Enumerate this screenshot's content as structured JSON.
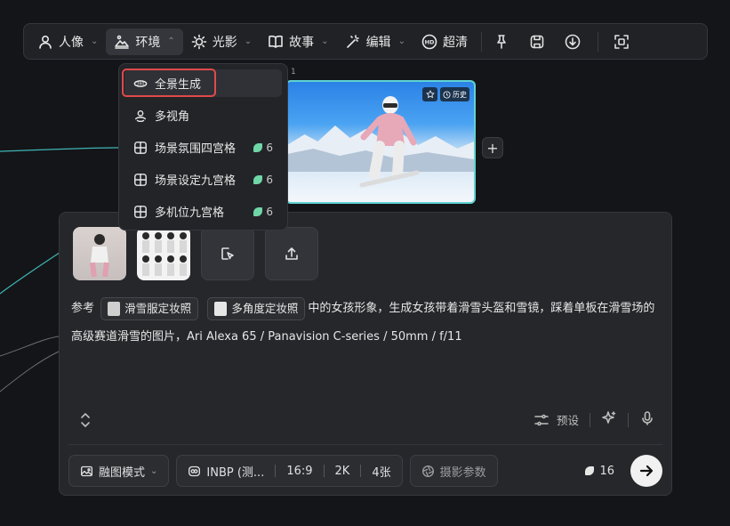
{
  "toolbar": {
    "items": [
      {
        "label": "人像",
        "icon": "person-icon"
      },
      {
        "label": "环境",
        "icon": "landscape-icon"
      },
      {
        "label": "光影",
        "icon": "sun-icon"
      },
      {
        "label": "故事",
        "icon": "book-icon"
      },
      {
        "label": "编辑",
        "icon": "magic-wand-icon"
      },
      {
        "label": "超清",
        "icon": "hd-icon"
      }
    ],
    "right_icons": [
      "pin-icon",
      "save-icon",
      "download-icon",
      "fullscreen-icon"
    ]
  },
  "dropdown": {
    "items": [
      {
        "label": "全景生成",
        "icon": "360-icon"
      },
      {
        "label": "多视角",
        "icon": "multi-view-icon"
      },
      {
        "label": "场景氛围四宫格",
        "icon": "grid-icon",
        "count": "6"
      },
      {
        "label": "场景设定九宫格",
        "icon": "grid-icon",
        "count": "6"
      },
      {
        "label": "多机位九宫格",
        "icon": "grid-icon",
        "count": "6"
      }
    ]
  },
  "image_card": {
    "node_label": "1",
    "history_label": "历史"
  },
  "prompt": {
    "prefix": "参考",
    "ref1": "滑雪服定妆照",
    "ref2": "多角度定妆照",
    "text": "中的女孩形象，生成女孩带着滑雪头盔和雪镜，踩着单板在滑雪场的高级赛道滑雪的图片，Ari Alexa 65 / Panavision C-series / 50mm / f/11"
  },
  "panel_tools": {
    "preset_label": "预设"
  },
  "bottom_bar": {
    "mode_label": "融图模式",
    "model_label": "INBP (测...",
    "ratio": "16:9",
    "resolution": "2K",
    "count": "4张",
    "camera_label": "摄影参数",
    "credits": "16"
  },
  "colors": {
    "accent_cyan": "#5fd3d3",
    "highlight_red": "#e04a4a",
    "leaf_green": "#6fd6a8"
  }
}
